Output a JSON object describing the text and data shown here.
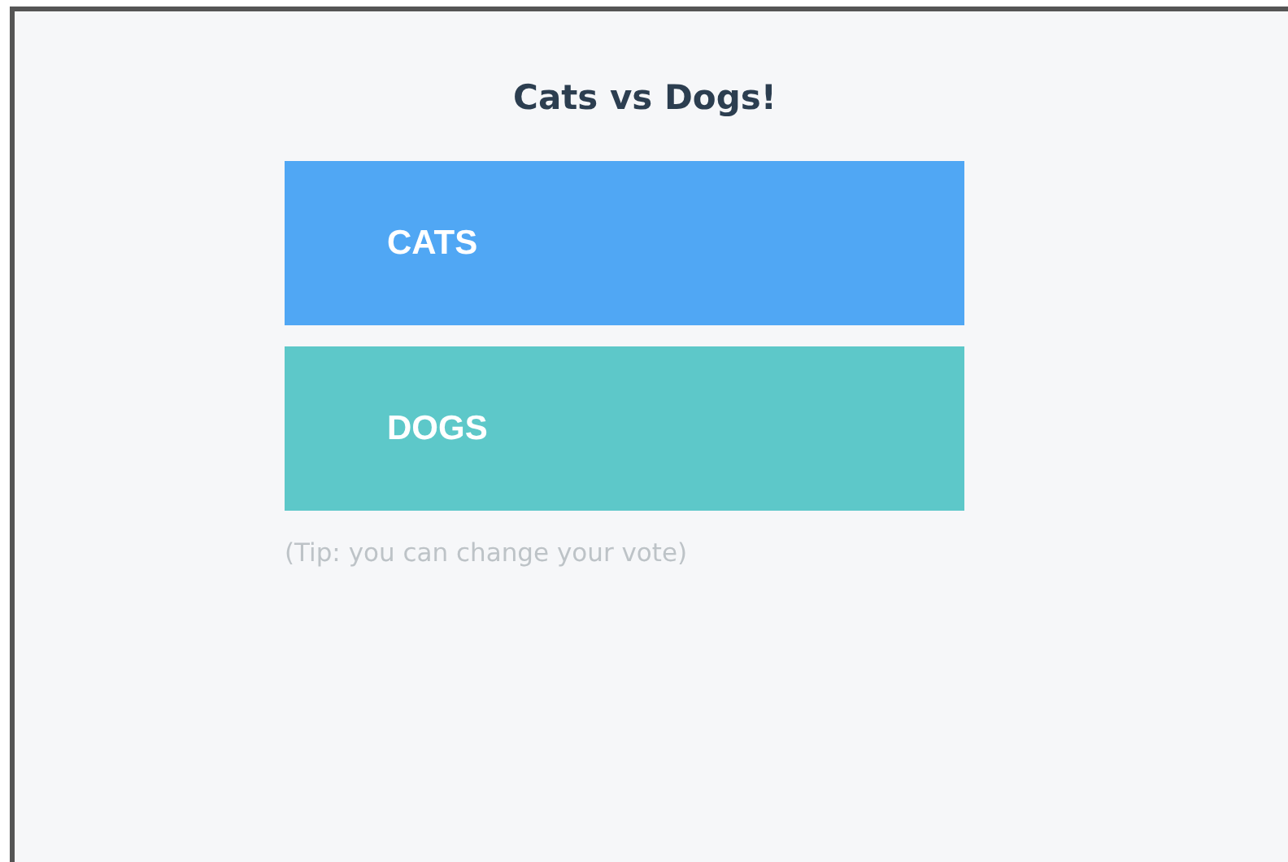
{
  "title": "Cats vs Dogs!",
  "options": [
    {
      "label": "CATS",
      "color": "#50a7f4"
    },
    {
      "label": "DOGS",
      "color": "#5dc8c9"
    }
  ],
  "tip": "(Tip: you can change your vote)"
}
